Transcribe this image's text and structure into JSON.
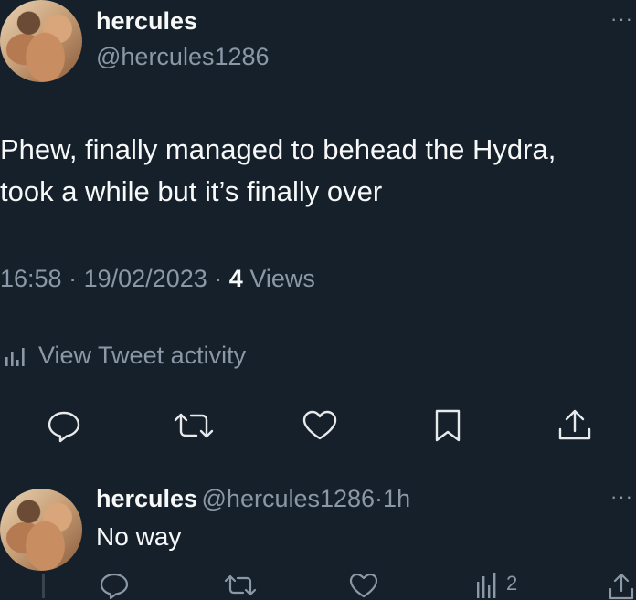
{
  "tweet": {
    "author_name": "hercules",
    "handle": "@hercules1286",
    "more_label": "···",
    "text_line1": "Phew, finally managed to behead the Hydra,",
    "text_line2": "took a while but it’s finally over",
    "time": "16:58",
    "date": "19/02/2023",
    "separator": "·",
    "views_count": "4",
    "views_label": "Views",
    "activity_label": "View Tweet activity"
  },
  "actions": {
    "icons": [
      "reply-icon",
      "retweet-icon",
      "like-icon",
      "bookmark-icon",
      "share-icon"
    ]
  },
  "reply": {
    "author_name": "hercules",
    "handle": "@hercules1286",
    "separator": "·",
    "time_ago": "1h",
    "text": "No way",
    "more_label": "···",
    "views_count": "2"
  },
  "colors": {
    "background": "#15202b",
    "primary_text": "#f7f9f9",
    "secondary_text": "#8b98a5",
    "divider": "#38444d"
  }
}
